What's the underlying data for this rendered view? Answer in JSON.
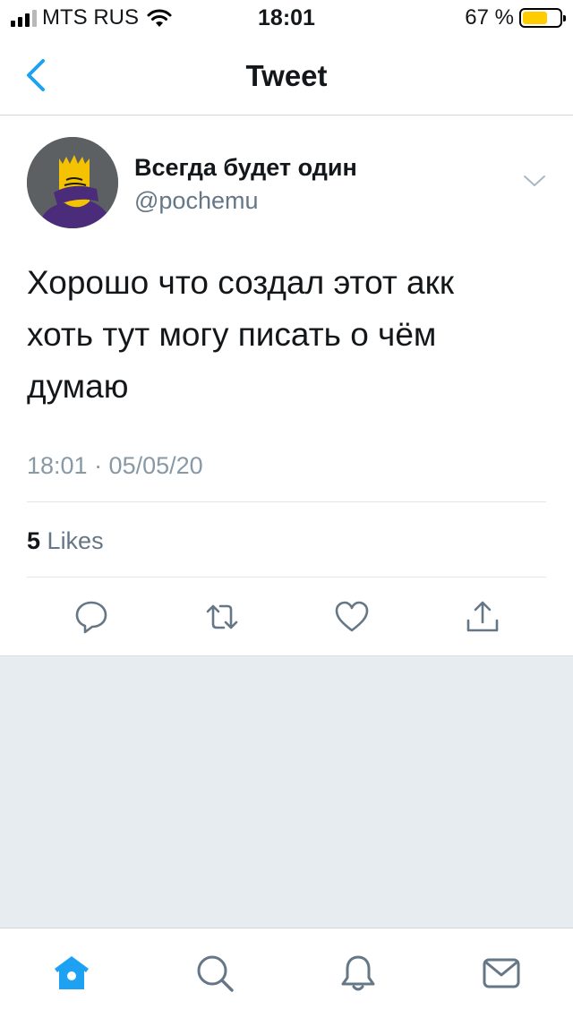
{
  "status_bar": {
    "carrier": "MTS RUS",
    "time": "18:01",
    "battery": "67 %",
    "battery_level": 0.67
  },
  "nav": {
    "title": "Tweet",
    "back_icon": "chevron-left-icon"
  },
  "tweet": {
    "author_name": "Всегда будет один",
    "author_handle": "@pochemu",
    "text": "Хорошо что создал этот акк хоть тут могу писать о чём думаю",
    "timestamp": "18:01 · 05/05/20",
    "likes_count": "5",
    "likes_label": "Likes",
    "actions": [
      "reply-icon",
      "retweet-icon",
      "like-icon",
      "share-icon"
    ]
  },
  "tab_bar": {
    "items": [
      "home-icon",
      "search-icon",
      "notifications-icon",
      "messages-icon"
    ],
    "active": "home-icon"
  },
  "colors": {
    "accent": "#1da1f2",
    "secondary_text": "#657786",
    "background": "#e6ecf0"
  }
}
